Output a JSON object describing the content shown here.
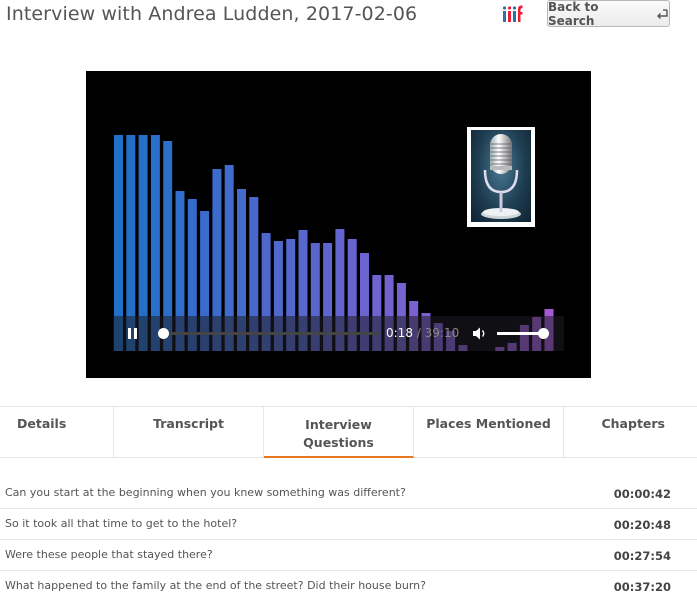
{
  "header": {
    "title": "Interview with Andrea Ludden, 2017-02-06",
    "iiif_icon": "iiif-logo-icon",
    "back_label": "Back to Search",
    "back_icon": "return-arrow-icon"
  },
  "player": {
    "state": "playing",
    "current_time": "0:18",
    "separator": "/",
    "duration": "39:10",
    "progress_fraction": 0.0077,
    "volume_fraction": 1.0,
    "artwork": "microphone-icon",
    "play_icon": "pause-icon",
    "volume_icon": "speaker-icon"
  },
  "tabs": [
    {
      "label": "Details"
    },
    {
      "label": "Transcript"
    },
    {
      "label": "Interview Questions",
      "active": true
    },
    {
      "label": "Places Mentioned"
    },
    {
      "label": "Chapters"
    }
  ],
  "questions": [
    {
      "text": "Can you start at the beginning when you knew something was different?",
      "time": "00:00:42"
    },
    {
      "text": "So it took all that time to get to the hotel?",
      "time": "00:20:48"
    },
    {
      "text": "Were these people that stayed there?",
      "time": "00:27:54"
    },
    {
      "text": "What happened to the family at the end of the street? Did their house burn?",
      "time": "00:37:20"
    }
  ],
  "colors": {
    "accent": "#e87722",
    "viz_start": "#1e70c8",
    "viz_end": "#a45ad4"
  }
}
